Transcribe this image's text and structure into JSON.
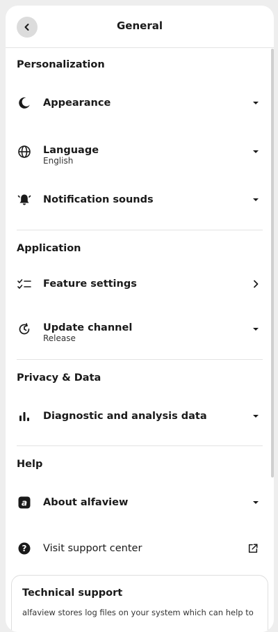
{
  "header": {
    "title": "General"
  },
  "sections": {
    "personalization": "Personalization",
    "application": "Application",
    "privacy": "Privacy & Data",
    "help": "Help"
  },
  "rows": {
    "appearance": {
      "label": "Appearance",
      "icon": "moon-icon"
    },
    "language": {
      "label": "Language",
      "sub": "English",
      "icon": "globe-icon"
    },
    "notification_sounds": {
      "label": "Notification sounds",
      "icon": "bell-icon"
    },
    "feature_settings": {
      "label": "Feature settings",
      "icon": "checklist-icon"
    },
    "update_channel": {
      "label": "Update channel",
      "sub": "Release",
      "icon": "update-icon"
    },
    "diagnostic": {
      "label": "Diagnostic and analysis data",
      "icon": "bar-chart-icon"
    },
    "about": {
      "label": "About alfaview",
      "icon": "alfaview-logo-icon"
    },
    "support": {
      "label": "Visit support center",
      "icon": "help-circle-icon"
    }
  },
  "technical_support": {
    "title": "Technical support",
    "text": "alfaview stores log files on your system which can help to"
  }
}
